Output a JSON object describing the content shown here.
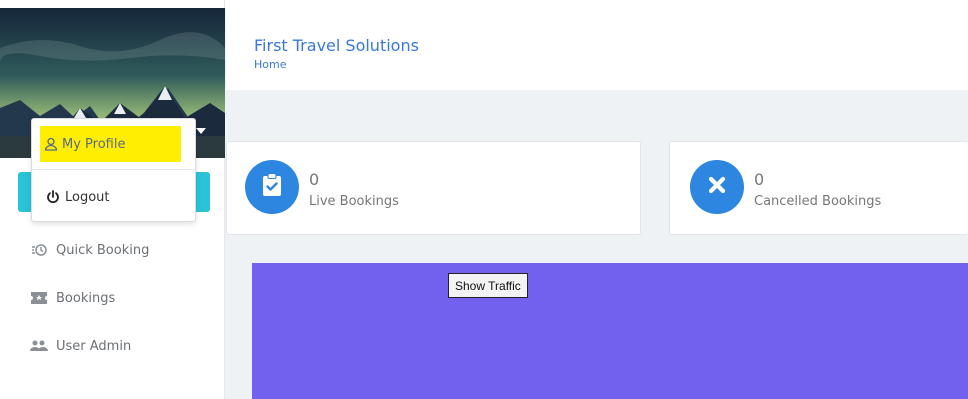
{
  "header": {
    "title": "First Travel Solutions",
    "breadcrumb": "Home"
  },
  "user_dropdown": {
    "profile_label": "My Profile",
    "logout_label": "Logout",
    "highlight_color": "#ffee00"
  },
  "sidebar": {
    "items": [
      {
        "label": "Quick Booking",
        "icon": "clock-icon"
      },
      {
        "label": "Bookings",
        "icon": "ticket-icon"
      },
      {
        "label": "User Admin",
        "icon": "users-icon"
      }
    ]
  },
  "stats": [
    {
      "count": "0",
      "label": "Live Bookings",
      "icon": "clipboard-check-icon"
    },
    {
      "count": "0",
      "label": "Cancelled Bookings",
      "icon": "close-icon"
    }
  ],
  "traffic": {
    "button_label": "Show Traffic",
    "panel_color": "#7260ee"
  },
  "colors": {
    "accent_blue": "#3a78d4",
    "stat_circle": "#2d86e0",
    "teal": "#29c4d8"
  }
}
